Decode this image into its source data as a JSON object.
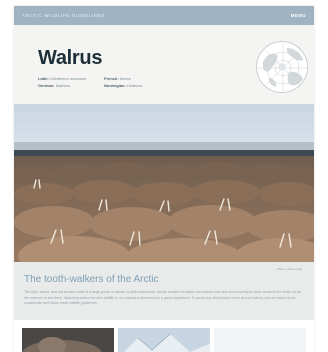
{
  "topbar": {
    "site_name": "ARCTIC WILDLIFE GUIDELINES",
    "menu_label": "MENU"
  },
  "header": {
    "title": "Walrus",
    "names": [
      {
        "lang": "Latin:",
        "value": "Odobenus rosmarus"
      },
      {
        "lang": "French:",
        "value": "Morse"
      },
      {
        "lang": "German:",
        "value": "Walross"
      },
      {
        "lang": "Norwegian:",
        "value": "Hvalross"
      }
    ]
  },
  "photo": {
    "credit": "Photo: photo credit"
  },
  "section": {
    "subtitle": "The tooth-walkers of the Arctic",
    "body": "The tight, sound, and not at least smell of a large group of walrus, is quite impressive. As the number of walrus and walrus haul-outs is increasing in some areas of the Arctic, so as the chances to see them. Watching walrus but also wildlife in our natural environment to a great experience. To avoid any disturbance when around walrus, you are asked to be considerate and follow these wildlife guidelines."
  },
  "colors": {
    "topbar": "#9fb3c2",
    "header_bg": "#f4f5f2",
    "subtitle": "#7d9fb5",
    "band": "#e8ebea"
  }
}
